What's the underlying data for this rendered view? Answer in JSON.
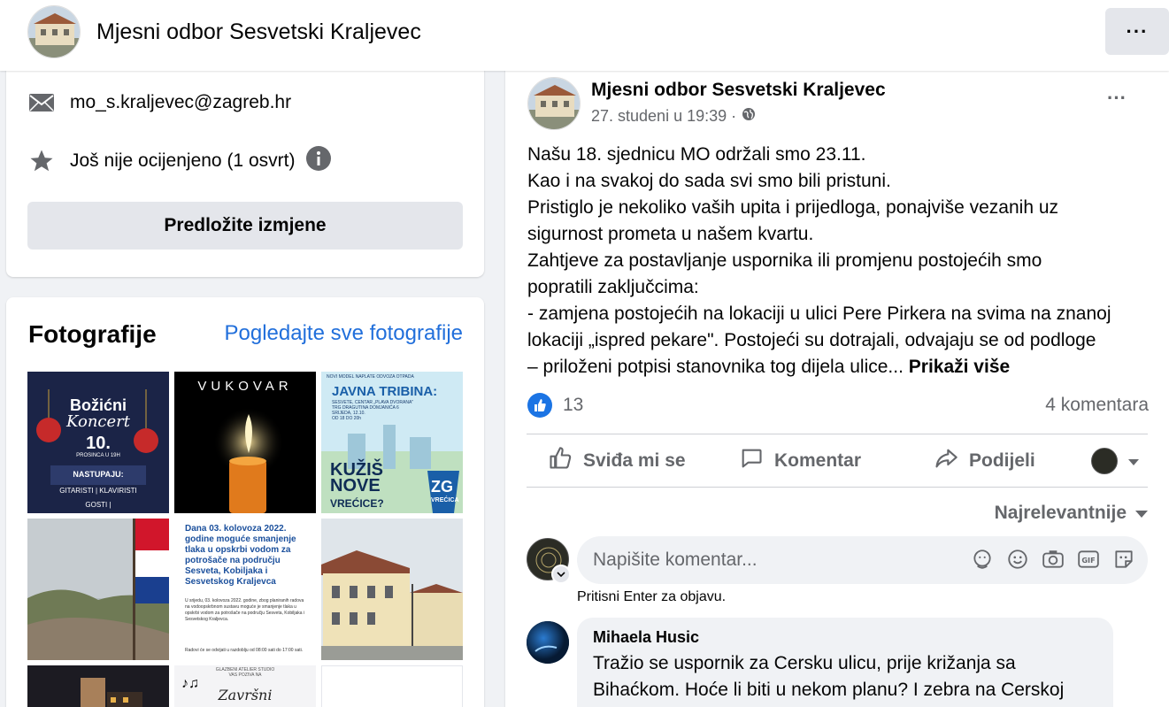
{
  "header": {
    "page_name": "Mjesni odbor Sesvetski Kraljevec",
    "more_label": "···"
  },
  "about": {
    "email": "mo_s.kraljevec@zagreb.hr",
    "rating": "Još nije ocijenjeno (1 osvrt)",
    "suggest_button": "Predložite izmjene"
  },
  "photos": {
    "title": "Fotografije",
    "see_all": "Pogledajte sve fotografije",
    "items": [
      {
        "kind": "concert",
        "lines": [
          "Božićni",
          "Koncert",
          "10.",
          "PROSINCA U 19H",
          "NASTUPAJU:",
          "GITARISTI | KLAVIRISTI",
          "GOSTI |"
        ]
      },
      {
        "kind": "vukovar",
        "lines": [
          "VUKOVAR"
        ]
      },
      {
        "kind": "tribina",
        "lines": [
          "NOVI MODEL NAPLATE ODVOZA OTPADA",
          "JAVNA TRIBINA:",
          "SESVETE, CENTAR „PLAVA DVORANA\"",
          "TRG DRAGUTINA DOMJANIĆA 6",
          "SRIJEDA, 12.10.",
          "OD 18 DO 20h",
          "KUŽIŠ",
          "NOVE",
          "VREĆICE?",
          "ZG",
          "VREĆICA"
        ]
      },
      {
        "kind": "flag",
        "lines": []
      },
      {
        "kind": "notice",
        "lines": [
          "Dana 03. kolovoza 2022. godine moguće smanjenje tlaka u opskrbi vodom za potrošače na području Sesveta, Kobiljaka i Sesvetskog Kraljevca",
          "U srijedu, 03. kolovoza 2022. godine, zbog planiranih radova na vodoopskrbnom sustavu moguće je smanjenje tlaka u opskrbi vodom za potrošače na području Sesveta, Kobiljaka i Sesvetskog Kraljevca.",
          "Radovi će se odvijati u razdoblju od 08:00 sati do 17:00 sati."
        ]
      },
      {
        "kind": "building",
        "lines": []
      },
      {
        "kind": "night",
        "lines": []
      },
      {
        "kind": "zavrsni",
        "lines": [
          "GLAZBENI ATELIER STUDIO",
          "VAS POZIVA NA",
          "Završni"
        ]
      },
      {
        "kind": "blank",
        "lines": []
      }
    ]
  },
  "post": {
    "author": "Mjesni odbor Sesvetski Kraljevec",
    "time": "27. studeni u 19:39 ·",
    "more": "···",
    "lines": [
      "Našu 18. sjednicu MO održali smo 23.11.",
      "Kao i na svakoj do sada svi smo bili pristuni.",
      "Pristiglo je nekoliko vaših upita i prijedloga, ponajviše vezanih uz",
      "sigurnost prometa u našem kvartu.",
      "Zahtjeve za postavljanje uspornika ili promjenu postojećih smo",
      "popratili zaključcima:",
      "- zamjena postojećih na lokaciji u ulici Pere Pirkera na svima na znanoj",
      "lokaciji „ispred pekare\". Postojeći su dotrajali, odvajaju se od podloge",
      "– priloženi potpisi stanovnika tog dijela ulice..."
    ],
    "see_more": "Prikaži više",
    "likes": "13",
    "comments": "4 komentara",
    "actions": {
      "like": "Sviđa mi se",
      "comment": "Komentar",
      "share": "Podijeli"
    },
    "sort": "Najrelevantnije",
    "comment_placeholder": "Napišite komentar...",
    "enter_hint": "Pritisni Enter za objavu.",
    "first_comment": {
      "name": "Mihaela Husic",
      "lines": [
        "Tražio se uspornik za Cersku ulicu, prije križanja sa",
        "Bihaćkom. Hoće li biti u nekom planu? I zebra na Cerskoj"
      ]
    }
  },
  "colors": {
    "link": "#216fdb",
    "like": "#1b74e4",
    "gray_text": "#65676b",
    "button_bg": "#e4e6eb"
  }
}
